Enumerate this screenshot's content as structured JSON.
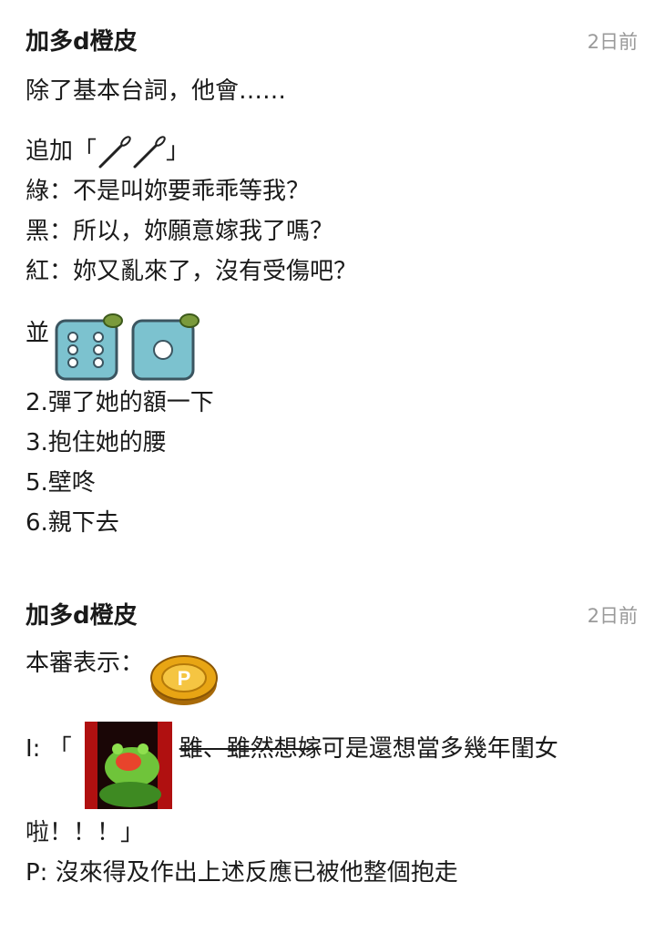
{
  "posts": [
    {
      "author": "加多d橙皮",
      "time": "2日前",
      "lines": {
        "l1": "除了基本台詞，他會……",
        "l2_pre": "追加「",
        "l2_post": "」",
        "l3": "綠：不是叫妳要乖乖等我？",
        "l4": "黑：所以，妳願意嫁我了嗎？",
        "l5": "紅：妳又亂來了，沒有受傷吧？",
        "l6_pre": "並",
        "l7": "2.彈了她的額一下",
        "l8": "3.抱住她的腰",
        "l9": "5.壁咚",
        "l10": "6.親下去"
      },
      "emotes": {
        "horns": "vuvuzela-emote",
        "dice_six": "dice-six-emote",
        "dice_one": "dice-one-emote"
      }
    },
    {
      "author": "加多d橙皮",
      "time": "2日前",
      "lines": {
        "l1": "本審表示：",
        "l2_pre": "I: 「",
        "l2_strike": "雖、雖然想嫁",
        "l2_post": "可是還想當多幾年閨女",
        "l3": "啦！！！」",
        "l4": "P: 沒來得及作出上述反應已被他整個抱走"
      },
      "emotes": {
        "coin": "p-coin-emote",
        "frog": "frog-sticker"
      }
    }
  ],
  "colors": {
    "text": "#1a1a1a",
    "time": "#9a9a9a",
    "dice": "#7cc2cf",
    "coin": "#e8a514"
  }
}
